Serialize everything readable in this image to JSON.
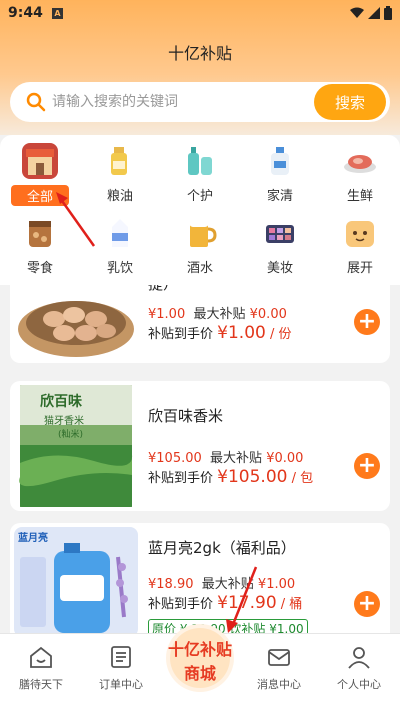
{
  "status_bar": {
    "time": "9:44",
    "notif_icon": "A"
  },
  "header": {
    "title": "十亿补贴"
  },
  "search": {
    "placeholder": "请输入搜索的关键词",
    "button": "搜索"
  },
  "categories": [
    {
      "label": "全部",
      "icon": "store-icon",
      "active": true
    },
    {
      "label": "粮油",
      "icon": "oil-icon"
    },
    {
      "label": "个护",
      "icon": "personal-care-icon"
    },
    {
      "label": "家清",
      "icon": "cleaning-icon"
    },
    {
      "label": "生鲜",
      "icon": "meat-icon"
    },
    {
      "label": "零食",
      "icon": "snack-icon"
    },
    {
      "label": "乳饮",
      "icon": "milk-icon"
    },
    {
      "label": "酒水",
      "icon": "beer-icon"
    },
    {
      "label": "美妆",
      "icon": "makeup-icon"
    },
    {
      "label": "展开",
      "icon": "expand-icon"
    }
  ],
  "products": [
    {
      "name": "提）",
      "price": "¥1.00",
      "max_subsidy_label": "最大补贴",
      "max_subsidy": "¥0.00",
      "final_label": "补贴到手价",
      "final_price": "¥1.00",
      "unit": "/ 份"
    },
    {
      "name": "欣百味香米",
      "price": "¥105.00",
      "max_subsidy_label": "最大补贴",
      "max_subsidy": "¥0.00",
      "final_label": "补贴到手价",
      "final_price": "¥105.00",
      "unit": "/ 包",
      "package_text_top": "欣百味",
      "package_text_mid": "猫牙香米",
      "package_text_small": "(籼米)"
    },
    {
      "name": "蓝月亮2gk（福利品）",
      "price": "¥18.90",
      "max_subsidy_label": "最大补贴",
      "max_subsidy": "¥1.00",
      "final_label": "补贴到手价",
      "final_price": "¥17.90",
      "unit": "/ 桶",
      "tag": "原价 ¥ 19.90  饮补贴 ¥1.00",
      "brand_logo": "蓝月亮"
    }
  ],
  "bottom_nav": [
    {
      "label": "膳待天下",
      "icon": "home-icon"
    },
    {
      "label": "订单中心",
      "icon": "order-icon"
    },
    {
      "label": "消息中心",
      "icon": "message-icon"
    },
    {
      "label": "个人中心",
      "icon": "profile-icon"
    }
  ],
  "center_badge": {
    "line1": "十亿补贴",
    "line2": "商城"
  },
  "colors": {
    "accent": "#ffa611",
    "price_red": "#e2361b",
    "active_tab": "#ff6f1e"
  }
}
